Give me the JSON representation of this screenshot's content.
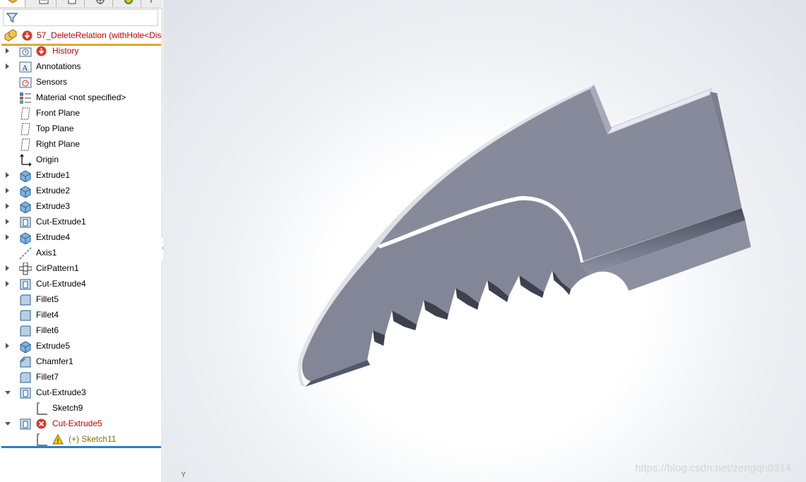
{
  "root": {
    "label": "57_DeleteRelation  (withHole<Dis"
  },
  "tree": [
    {
      "label": "History",
      "icon": "history-folder-icon",
      "arrow": "closed",
      "status": "error"
    },
    {
      "label": "Annotations",
      "icon": "annotations-icon",
      "arrow": "closed"
    },
    {
      "label": "Sensors",
      "icon": "sensors-icon",
      "arrow": "none"
    },
    {
      "label": "Material <not specified>",
      "icon": "material-icon",
      "arrow": "none"
    },
    {
      "label": "Front Plane",
      "icon": "plane-icon",
      "arrow": "none"
    },
    {
      "label": "Top Plane",
      "icon": "plane-icon",
      "arrow": "none"
    },
    {
      "label": "Right Plane",
      "icon": "plane-icon",
      "arrow": "none"
    },
    {
      "label": "Origin",
      "icon": "origin-icon",
      "arrow": "none"
    },
    {
      "label": "Extrude1",
      "icon": "extrude-icon",
      "arrow": "closed"
    },
    {
      "label": "Extrude2",
      "icon": "extrude-icon",
      "arrow": "closed"
    },
    {
      "label": "Extrude3",
      "icon": "extrude-icon",
      "arrow": "closed"
    },
    {
      "label": "Cut-Extrude1",
      "icon": "cut-extrude-icon",
      "arrow": "closed"
    },
    {
      "label": "Extrude4",
      "icon": "extrude-icon",
      "arrow": "closed"
    },
    {
      "label": "Axis1",
      "icon": "axis-icon",
      "arrow": "none"
    },
    {
      "label": "CirPattern1",
      "icon": "circular-pattern-icon",
      "arrow": "closed"
    },
    {
      "label": "Cut-Extrude4",
      "icon": "cut-extrude-icon",
      "arrow": "closed"
    },
    {
      "label": "Fillet5",
      "icon": "fillet-icon",
      "arrow": "none"
    },
    {
      "label": "Fillet4",
      "icon": "fillet-icon",
      "arrow": "none"
    },
    {
      "label": "Fillet6",
      "icon": "fillet-icon",
      "arrow": "none"
    },
    {
      "label": "Extrude5",
      "icon": "extrude-icon",
      "arrow": "closed"
    },
    {
      "label": "Chamfer1",
      "icon": "chamfer-icon",
      "arrow": "none"
    },
    {
      "label": "Fillet7",
      "icon": "fillet-icon",
      "arrow": "none"
    },
    {
      "label": "Cut-Extrude3",
      "icon": "cut-extrude-icon",
      "arrow": "open"
    },
    {
      "label": "Sketch9",
      "icon": "sketch-icon",
      "arrow": "none",
      "child": true
    },
    {
      "label": "Cut-Extrude5",
      "icon": "cut-extrude-icon",
      "arrow": "open",
      "status": "error"
    },
    {
      "label": "(+) Sketch11",
      "icon": "sketch-icon",
      "arrow": "none",
      "child": true,
      "status": "warning"
    }
  ],
  "viewport": {
    "triad_label": "Y"
  },
  "watermark": "https://blog.csdn.net/zengqh0314",
  "colors": {
    "error": "#c00000",
    "warning_text": "#807000",
    "root_underline": "#e2a53a",
    "selection_line": "#2d7fc1",
    "part_face": "#888c9c"
  }
}
